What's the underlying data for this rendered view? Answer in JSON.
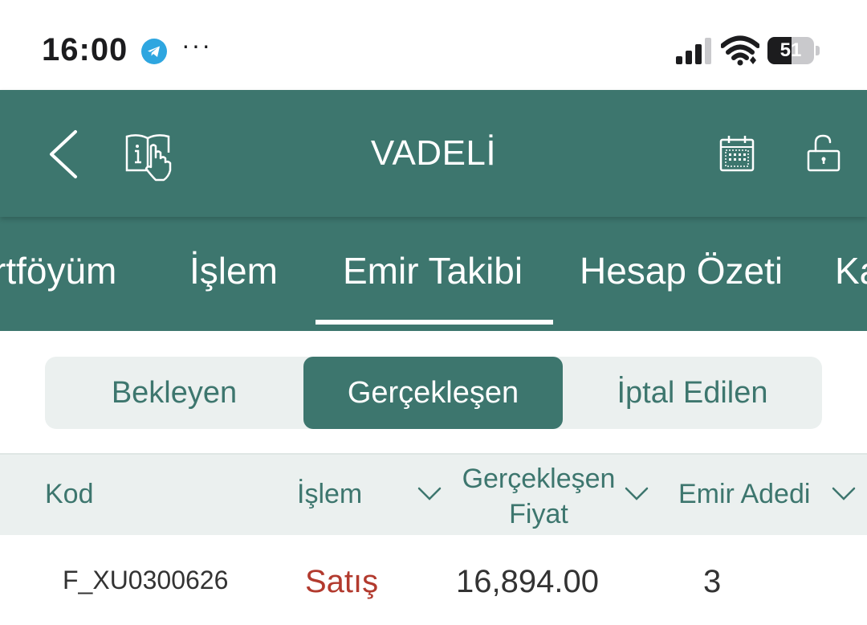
{
  "status_bar": {
    "time": "16:00",
    "more": "···",
    "battery_level": "51",
    "battery_fraction": 0.51
  },
  "header": {
    "title": "VADELİ",
    "icons": [
      "back-icon",
      "guide-book-icon",
      "calendar-icon",
      "unlock-icon"
    ]
  },
  "tabs": [
    {
      "label": "rtföyüm"
    },
    {
      "label": "İşlem"
    },
    {
      "label": "Emir Takibi",
      "active": true
    },
    {
      "label": "Hesap Özeti"
    },
    {
      "label": "Ka"
    }
  ],
  "segments": [
    {
      "label": "Bekleyen"
    },
    {
      "label": "Gerçekleşen",
      "active": true
    },
    {
      "label": "İptal Edilen"
    }
  ],
  "table": {
    "columns": [
      {
        "label": "Kod"
      },
      {
        "label": "İşlem"
      },
      {
        "label": "Gerçekleşen\nFiyat"
      },
      {
        "label": "Emir Adedi"
      }
    ],
    "rows": [
      {
        "kod": "F_XU0300626",
        "islem": "Satış",
        "fiyat": "16,894.00",
        "adet": "3"
      }
    ]
  },
  "colors": {
    "primary": "#3d766e",
    "light_bg": "#ebf0ef",
    "sell": "#b23a2e",
    "text_dark": "#333333"
  }
}
